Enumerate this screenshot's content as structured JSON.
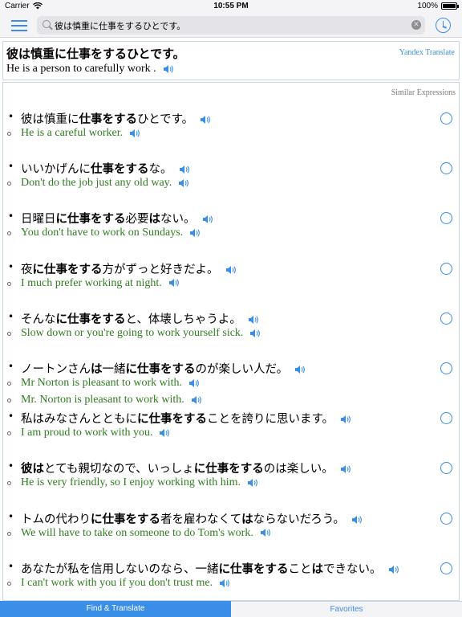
{
  "status_bar": {
    "carrier": "Carrier",
    "time": "10:55 PM",
    "battery_text": "100%",
    "battery_level": 1.0
  },
  "search": {
    "query": "彼は慎重に仕事をするひとです。"
  },
  "translation": {
    "source_text": "彼は慎重に仕事をするひとです。",
    "translated_text": "He is a person to carefully work .",
    "provider_label": "Yandex Translate"
  },
  "similar": {
    "header": "Similar Expressions",
    "items": [
      {
        "jp": [
          [
            "彼は慎重に",
            false
          ],
          [
            "仕事をする",
            true
          ],
          [
            "ひとです。",
            false
          ]
        ],
        "en": [
          "He is a careful worker."
        ]
      },
      {
        "jp": [
          [
            "いいかげんに",
            false
          ],
          [
            "仕事をする",
            true
          ],
          [
            "な。",
            false
          ]
        ],
        "en": [
          "Don't do the job just any old way."
        ]
      },
      {
        "jp": [
          [
            "日曜日",
            false
          ],
          [
            "に仕事をする",
            true
          ],
          [
            "必要",
            false
          ],
          [
            "は",
            true
          ],
          [
            "ない。",
            false
          ]
        ],
        "en": [
          "You don't have to work on Sundays."
        ]
      },
      {
        "jp": [
          [
            "夜",
            false
          ],
          [
            "に仕事をする",
            true
          ],
          [
            "方がずっと好きだよ。",
            false
          ]
        ],
        "en": [
          "I much prefer working at night."
        ]
      },
      {
        "jp": [
          [
            "そんな",
            false
          ],
          [
            "に仕事をする",
            true
          ],
          [
            "と、体壊しちゃうよ。",
            false
          ]
        ],
        "en": [
          "Slow down or you're going to work yourself sick."
        ]
      },
      {
        "jp": [
          [
            "ノートンさん",
            false
          ],
          [
            "は",
            true
          ],
          [
            "一緒",
            false
          ],
          [
            "に仕事をする",
            true
          ],
          [
            "のが楽しい人だ。",
            false
          ]
        ],
        "en": [
          "Mr Norton is pleasant to work with.",
          "Mr. Norton is pleasant to work with."
        ]
      },
      {
        "jp": [
          [
            "私はみなさんとともに",
            false
          ],
          [
            "に仕事をする",
            true
          ],
          [
            "ことを誇りに思います。",
            false
          ]
        ],
        "en": [
          "I am proud to work with you."
        ]
      },
      {
        "jp": [
          [
            "彼は",
            true
          ],
          [
            "とても親切なので、いっしょ",
            false
          ],
          [
            "に仕事をする",
            true
          ],
          [
            "のは楽しい。",
            false
          ]
        ],
        "en": [
          "He is very friendly, so I enjoy working with him."
        ]
      },
      {
        "jp": [
          [
            "トムの代わり",
            false
          ],
          [
            "に仕事をする",
            true
          ],
          [
            "者を雇わなくて",
            false
          ],
          [
            "は",
            true
          ],
          [
            "ならないだろう。",
            false
          ]
        ],
        "en": [
          "We will have to take on someone to do Tom's work."
        ]
      },
      {
        "jp": [
          [
            "あなたが私を信用しないのなら、一緒",
            false
          ],
          [
            "に仕事をする",
            true
          ],
          [
            "こと",
            false
          ],
          [
            "は",
            true
          ],
          [
            "できない。",
            false
          ]
        ],
        "en": [
          "I can't work with you if you don't trust me."
        ]
      }
    ]
  },
  "tabs": {
    "find_translate": "Find & Translate",
    "favorites": "Favorites"
  },
  "colors": {
    "accent": "#3a8ee6",
    "english_green": "#2e7d1e"
  }
}
